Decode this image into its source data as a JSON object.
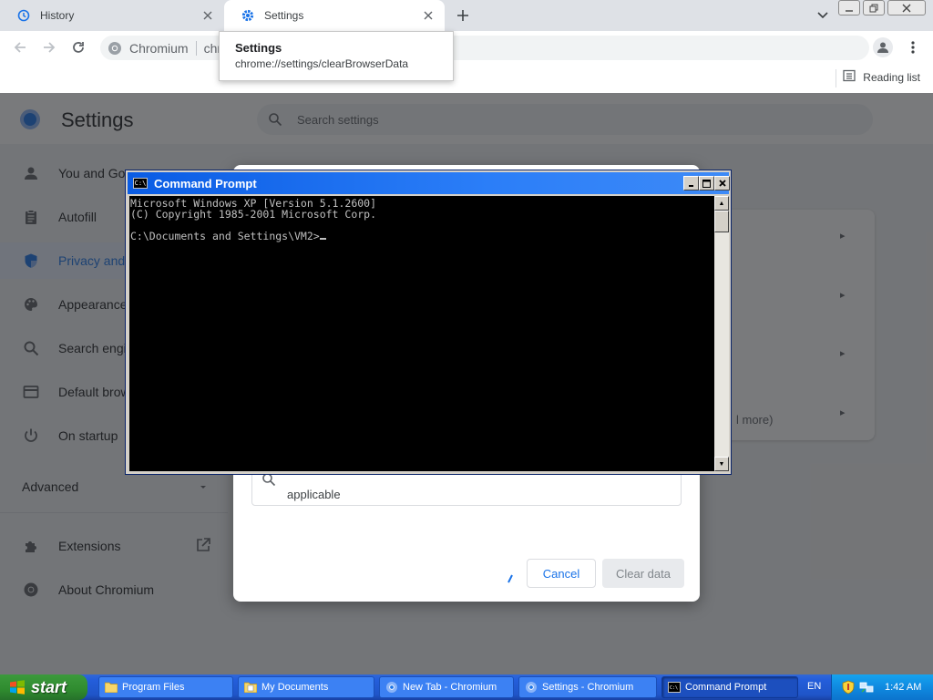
{
  "browser": {
    "tabs": [
      {
        "label": "History"
      },
      {
        "label": "Settings"
      }
    ],
    "omnibox": {
      "site": "Chromium",
      "url_prefix": "chr"
    },
    "reading_list": "Reading list",
    "tooltip": {
      "title": "Settings",
      "url": "chrome://settings/clearBrowserData"
    }
  },
  "settings": {
    "title": "Settings",
    "search_placeholder": "Search settings",
    "nav": [
      {
        "label": "You and Go",
        "icon": "person-icon"
      },
      {
        "label": "Autofill",
        "icon": "clipboard-icon"
      },
      {
        "label": "Privacy and",
        "icon": "shield-icon"
      },
      {
        "label": "Appearance",
        "icon": "palette-icon"
      },
      {
        "label": "Search engi",
        "icon": "search-icon"
      },
      {
        "label": "Default brow",
        "icon": "browser-icon"
      },
      {
        "label": "On startup",
        "icon": "power-icon"
      }
    ],
    "advanced": "Advanced",
    "extensions": "Extensions",
    "about": "About Chromium",
    "card_more": "l more)",
    "dialog": {
      "field_text": "applicable",
      "cancel": "Cancel",
      "clear": "Clear data"
    }
  },
  "cmd": {
    "title": "Command Prompt",
    "lines": [
      "Microsoft Windows XP [Version 5.1.2600]",
      "(C) Copyright 1985-2001 Microsoft Corp.",
      "",
      "C:\\Documents and Settings\\VM2>"
    ]
  },
  "taskbar": {
    "start": "start",
    "tasks": [
      {
        "label": "Program Files",
        "icon": "folder-icon"
      },
      {
        "label": "My Documents",
        "icon": "documents-icon"
      },
      {
        "label": "New Tab - Chromium",
        "icon": "chromium-icon"
      },
      {
        "label": "Settings - Chromium",
        "icon": "chromium-icon"
      },
      {
        "label": "Command Prompt",
        "icon": "cmd-icon"
      }
    ],
    "lang": "EN",
    "clock": "1:42 AM"
  },
  "colors": {
    "accent": "#1a73e8",
    "xp_taskbar": "#245edb",
    "xp_start": "#2f8b2f"
  }
}
